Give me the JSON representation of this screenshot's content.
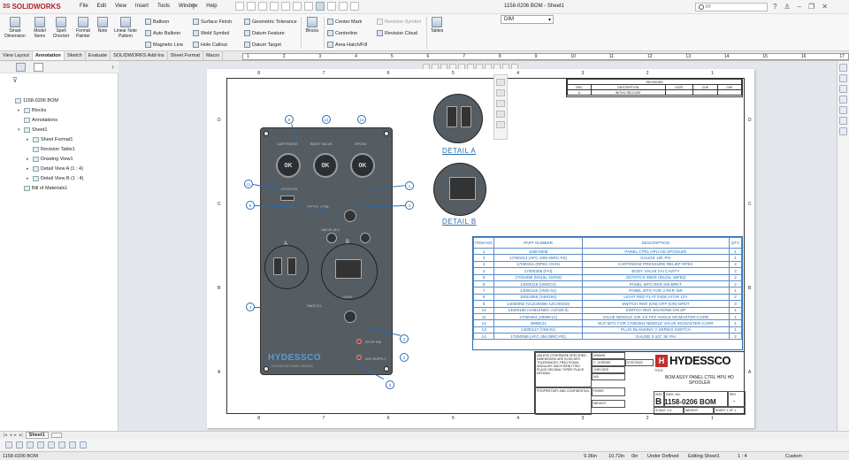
{
  "app": {
    "logo_ds": "3S",
    "logo": "SOLIDWORKS",
    "document_title": "1158-0206 BOM - Sheet1",
    "search_text": "rrr"
  },
  "menu": [
    "File",
    "Edit",
    "View",
    "Insert",
    "Tools",
    "Window",
    "Help"
  ],
  "ribbon": {
    "big": [
      "Smart Dimension",
      "Model Items",
      "Spell Checker",
      "Format Painter",
      "Note",
      "Linear Note Pattern"
    ],
    "col1": [
      "Balloon",
      "Auto Balloon",
      "Magnetic Line"
    ],
    "col2": [
      "Surface Finish",
      "Weld Symbol",
      "Hole Callout"
    ],
    "col3": [
      "Geometric Tolerance",
      "Datum Feature",
      "Datum Target"
    ],
    "blocks": "Blocks",
    "col4": [
      "Center Mark",
      "Centerline",
      "Area Hatch/Fill"
    ],
    "col5_disabled": [
      "Revision Symbol",
      "Revision Cloud"
    ],
    "tables": "Tables",
    "dim_style": "DIM"
  },
  "tabs": [
    "View Layout",
    "Annotation",
    "Sketch",
    "Evaluate",
    "SOLIDWORKS Add-Ins",
    "Sheet Format",
    "Macro"
  ],
  "active_tab": "Annotation",
  "ruler": [
    "1",
    "2",
    "3",
    "4",
    "5",
    "6",
    "7",
    "8",
    "9",
    "10",
    "11",
    "12",
    "13",
    "14",
    "15",
    "16",
    "17"
  ],
  "tree": [
    {
      "label": "1158-0206 BOM",
      "depth": 0,
      "expander": ""
    },
    {
      "label": "Blocks",
      "depth": 1,
      "expander": "▸"
    },
    {
      "label": "Annotations",
      "depth": 1,
      "expander": ""
    },
    {
      "label": "Sheet1",
      "depth": 1,
      "expander": "▾"
    },
    {
      "label": "Sheet Format1",
      "depth": 2,
      "expander": "▸"
    },
    {
      "label": "Revision Table1",
      "depth": 2,
      "expander": ""
    },
    {
      "label": "Drawing View1",
      "depth": 2,
      "expander": "▸"
    },
    {
      "label": "Detail View A (1 : 4)",
      "depth": 2,
      "expander": "▸"
    },
    {
      "label": "Detail View B (1 : 4)",
      "depth": 2,
      "expander": "▸"
    },
    {
      "label": "Bill of Materials1",
      "depth": 1,
      "expander": ""
    }
  ],
  "sheet_grid": {
    "top": [
      "8",
      "7",
      "6",
      "5",
      "4",
      "3",
      "2",
      "1"
    ],
    "side": [
      "D",
      "C",
      "B",
      "A"
    ]
  },
  "panel": {
    "gauge_labels": [
      "CARTRIDGE",
      "BODY VALVE",
      "SPOOL"
    ],
    "gauge_text": "0K",
    "logo": "HYDESSCO",
    "sub": "HYDRAULIC PANEL DESIGN",
    "small_labels": [
      "JOYSTICK",
      "SPOOL CTRL",
      "VALVE ADJ",
      "LIGHT",
      "SWITCH",
      "PLUG 12V",
      "STOP SW",
      "20V SUPPLY"
    ]
  },
  "balloons": [
    "8",
    "14",
    "14",
    "11",
    "6",
    "1",
    "3",
    "4",
    "2",
    "2",
    "5",
    "6"
  ],
  "details": {
    "a_letter": "A",
    "b_letter": "B",
    "a": "DETAIL A",
    "b": "DETAIL B"
  },
  "revision": {
    "title": "REVISIONS",
    "headers": [
      "REV",
      "DESCRIPTION",
      "DATE",
      "CHK",
      "CHK"
    ],
    "row": [
      "A",
      "INITIAL RELEASE",
      "",
      "",
      ""
    ]
  },
  "bom": {
    "headers": [
      "ITEM NO.",
      "PART NUMBER",
      "DESCRIPTION",
      "QTY."
    ],
    "rows": [
      [
        "1",
        "1158-0206",
        "PANEL CTRL HPU HD SPOOLER",
        "1"
      ],
      [
        "2",
        "17000414 (AFC-10M-25RC-FE)",
        "GAUGE 10K PAI",
        "1"
      ],
      [
        "3",
        "17000311 (RPEC-OCN)",
        "CARTRIDGE PRESSURE RELIEF RPEC",
        "2"
      ],
      [
        "4",
        "17000306 (FAI)",
        "BODY VALVE FAI CAVITY",
        "2"
      ],
      [
        "5",
        "17010498 (M115L-15F62)",
        "JOYSTICK 8IDIR (M115L-15F62)",
        "2"
      ],
      [
        "6",
        "14000118 (VMSO1)",
        "PANEL MTG RKR SW BRKT",
        "2"
      ],
      [
        "7",
        "14000116 (VMS-01)",
        "PANEL MTG FOR 3 RKR SW",
        "1"
      ],
      [
        "8",
        "15010356 (24M164)",
        "LIGHT RED FLAT INDICATOR 12V",
        "2"
      ],
      [
        "9",
        "14000092 (VLD2500B-AZC00X00)",
        "SWITCH RKR (ON)-OFF-(ON) DPDT",
        "3"
      ],
      [
        "10",
        "14000168 (VAB15NDC-AZA00-0)",
        "SWITCH RKR ON-NONE-ON SP",
        "1"
      ],
      [
        "11",
        "17000464 (4999K12)",
        "VALVE NEEDLE 10K 1/4 FKF ANGLE MCMASTER-CARR",
        "1"
      ],
      [
        "12",
        "4999K21",
        "NUT MTG FOR 17000464 NEEDLE VALVE MCMASTER-CARR",
        "1"
      ],
      [
        "13",
        "14000117 (VMI-01)",
        "PLUG BLANKING V SERIES SWITCH",
        "1"
      ],
      [
        "14",
        "17000069 (AFC-3M-25RC-FE)",
        "GAUGE 2-1/2\" 3K PAI",
        "2"
      ]
    ]
  },
  "titleblock": {
    "notes": "UNLESS OTHERWISE SPECIFIED: DIMENSIONS ARE IN INCHES TOLERANCES: FRACTIONAL ANGULAR: MACH BEND TWO PLACE DECIMAL THREE PLACE DECIMAL",
    "drawn": "DRAWN",
    "drawn_name": "C. GORDEE",
    "drawn_date": "07/07/2020",
    "checked": "CHECKED",
    "na": "N/A",
    "finish": "FINISH",
    "weight_label": "WEIGHT:",
    "proprietary": "PROPRIETARY AND CONFIDENTIAL",
    "logo": "HYDESSCO",
    "title_label": "TITLE:",
    "title": "BOM ASSY PANEL CTRL HPU HD SPOOLER",
    "size_label": "SIZE",
    "size": "B",
    "dwg_label": "DWG. NO.",
    "dwg_no": "1158-0206 BOM",
    "rev_label": "REV",
    "rev": "-",
    "scale": "SCALE: 1:4",
    "weight": "WEIGHT:",
    "sheet": "SHEET 1 OF 1"
  },
  "sheet_tab": "Sheet1",
  "status": {
    "name": "1158-0206 BOM",
    "x": "9.36in",
    "y": "10.72in",
    "z": "0in",
    "state": "Under Defined",
    "editing": "Editing Sheet1",
    "scale": "1 : 4",
    "units": "Custom"
  }
}
